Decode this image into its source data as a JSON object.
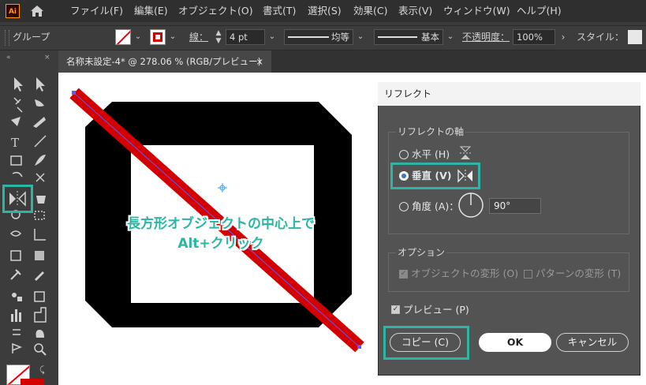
{
  "app": {
    "logo": "Ai"
  },
  "menu": [
    "ファイル(F)",
    "編集(E)",
    "オブジェクト(O)",
    "書式(T)",
    "選択(S)",
    "効果(C)",
    "表示(V)",
    "ウィンドウ(W)",
    "ヘルプ(H)"
  ],
  "control": {
    "selection": "グループ",
    "stroke_label": "線：",
    "stroke_value": "4 pt",
    "profile_uniform": "均等",
    "brush_basic": "基本",
    "opacity_label": "不透明度：",
    "opacity_value": "100%",
    "style_label": "スタイル："
  },
  "tab": {
    "title": "名称未設定-4* @ 278.06 % (RGB/プレビュー)",
    "close": "×"
  },
  "annotation": {
    "line1": "長方形オブジェクトの中心上で",
    "line2": "Alt+クリック"
  },
  "dialog": {
    "title": "リフレクト",
    "axis_group": "リフレクトの軸",
    "horizontal": "水平 (H)",
    "vertical": "垂直 (V)",
    "angle": "角度 (A)：",
    "angle_value": "90°",
    "options_group": "オプション",
    "transform_objects": "オブジェクトの変形 (O)",
    "transform_patterns": "パターンの変形 (T)",
    "preview": "プレビュー (P)",
    "copy": "コピー (C)",
    "ok": "OK",
    "cancel": "キャンセル"
  },
  "colors": {
    "accent": "#2bb5a3",
    "object_red": "#d40000",
    "object_black": "#000000",
    "radio_blue": "#2c78d4"
  }
}
